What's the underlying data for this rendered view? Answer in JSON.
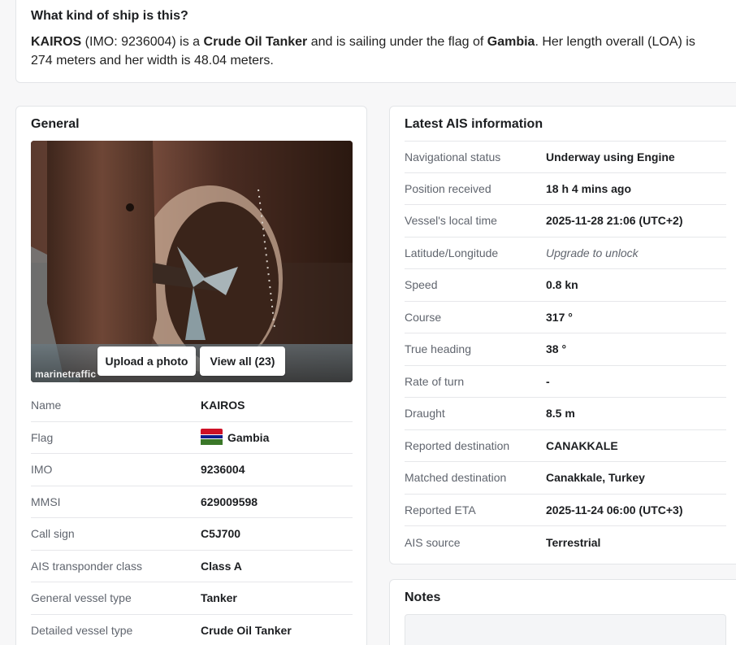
{
  "summary": {
    "question": "What kind of ship is this?",
    "ship_name": "KAIROS",
    "imo_text": " (IMO: 9236004) is a ",
    "ship_type": "Crude Oil Tanker",
    "flag_text": " and is sailing under the flag of ",
    "flag_country": "Gambia",
    "dimensions_text": ". Her length overall (LOA) is 274 meters and her width is 48.04 meters."
  },
  "general": {
    "title": "General",
    "photo": {
      "upload_label": "Upload a photo",
      "view_all_label": "View all (23)",
      "watermark": "marinetraffic"
    },
    "rows": [
      {
        "label": "Name",
        "value": "KAIROS"
      },
      {
        "label": "Flag",
        "value": "Gambia",
        "flag_icon": "gambia-flag-icon"
      },
      {
        "label": "IMO",
        "value": "9236004"
      },
      {
        "label": "MMSI",
        "value": "629009598"
      },
      {
        "label": "Call sign",
        "value": "C5J700"
      },
      {
        "label": "AIS transponder class",
        "value": "Class A"
      },
      {
        "label": "General vessel type",
        "value": "Tanker"
      },
      {
        "label": "Detailed vessel type",
        "value": "Crude Oil Tanker"
      }
    ]
  },
  "ais": {
    "title": "Latest AIS information",
    "rows": [
      {
        "label": "Navigational status",
        "value": "Underway using Engine"
      },
      {
        "label": "Position received",
        "value": "18 h 4 mins ago"
      },
      {
        "label": "Vessel's local time",
        "value": "2025-11-28 21:06 (UTC+2)"
      },
      {
        "label": "Latitude/Longitude",
        "value": "Upgrade to unlock"
      },
      {
        "label": "Speed",
        "value": "0.8 kn"
      },
      {
        "label": "Course",
        "value": "317 °"
      },
      {
        "label": "True heading",
        "value": "38 °"
      },
      {
        "label": "Rate of turn",
        "value": "-"
      },
      {
        "label": "Draught",
        "value": "8.5 m"
      },
      {
        "label": "Reported destination",
        "value": "CANAKKALE"
      },
      {
        "label": "Matched destination",
        "value": "Canakkale, Turkey"
      },
      {
        "label": "Reported ETA",
        "value": "2025-11-24 06:00 (UTC+3)"
      },
      {
        "label": "AIS source",
        "value": "Terrestrial"
      }
    ]
  },
  "notes": {
    "title": "Notes"
  },
  "colors": {
    "flag_red": "#ce1126",
    "flag_blue": "#0c1c8c",
    "flag_green": "#3a7728"
  }
}
